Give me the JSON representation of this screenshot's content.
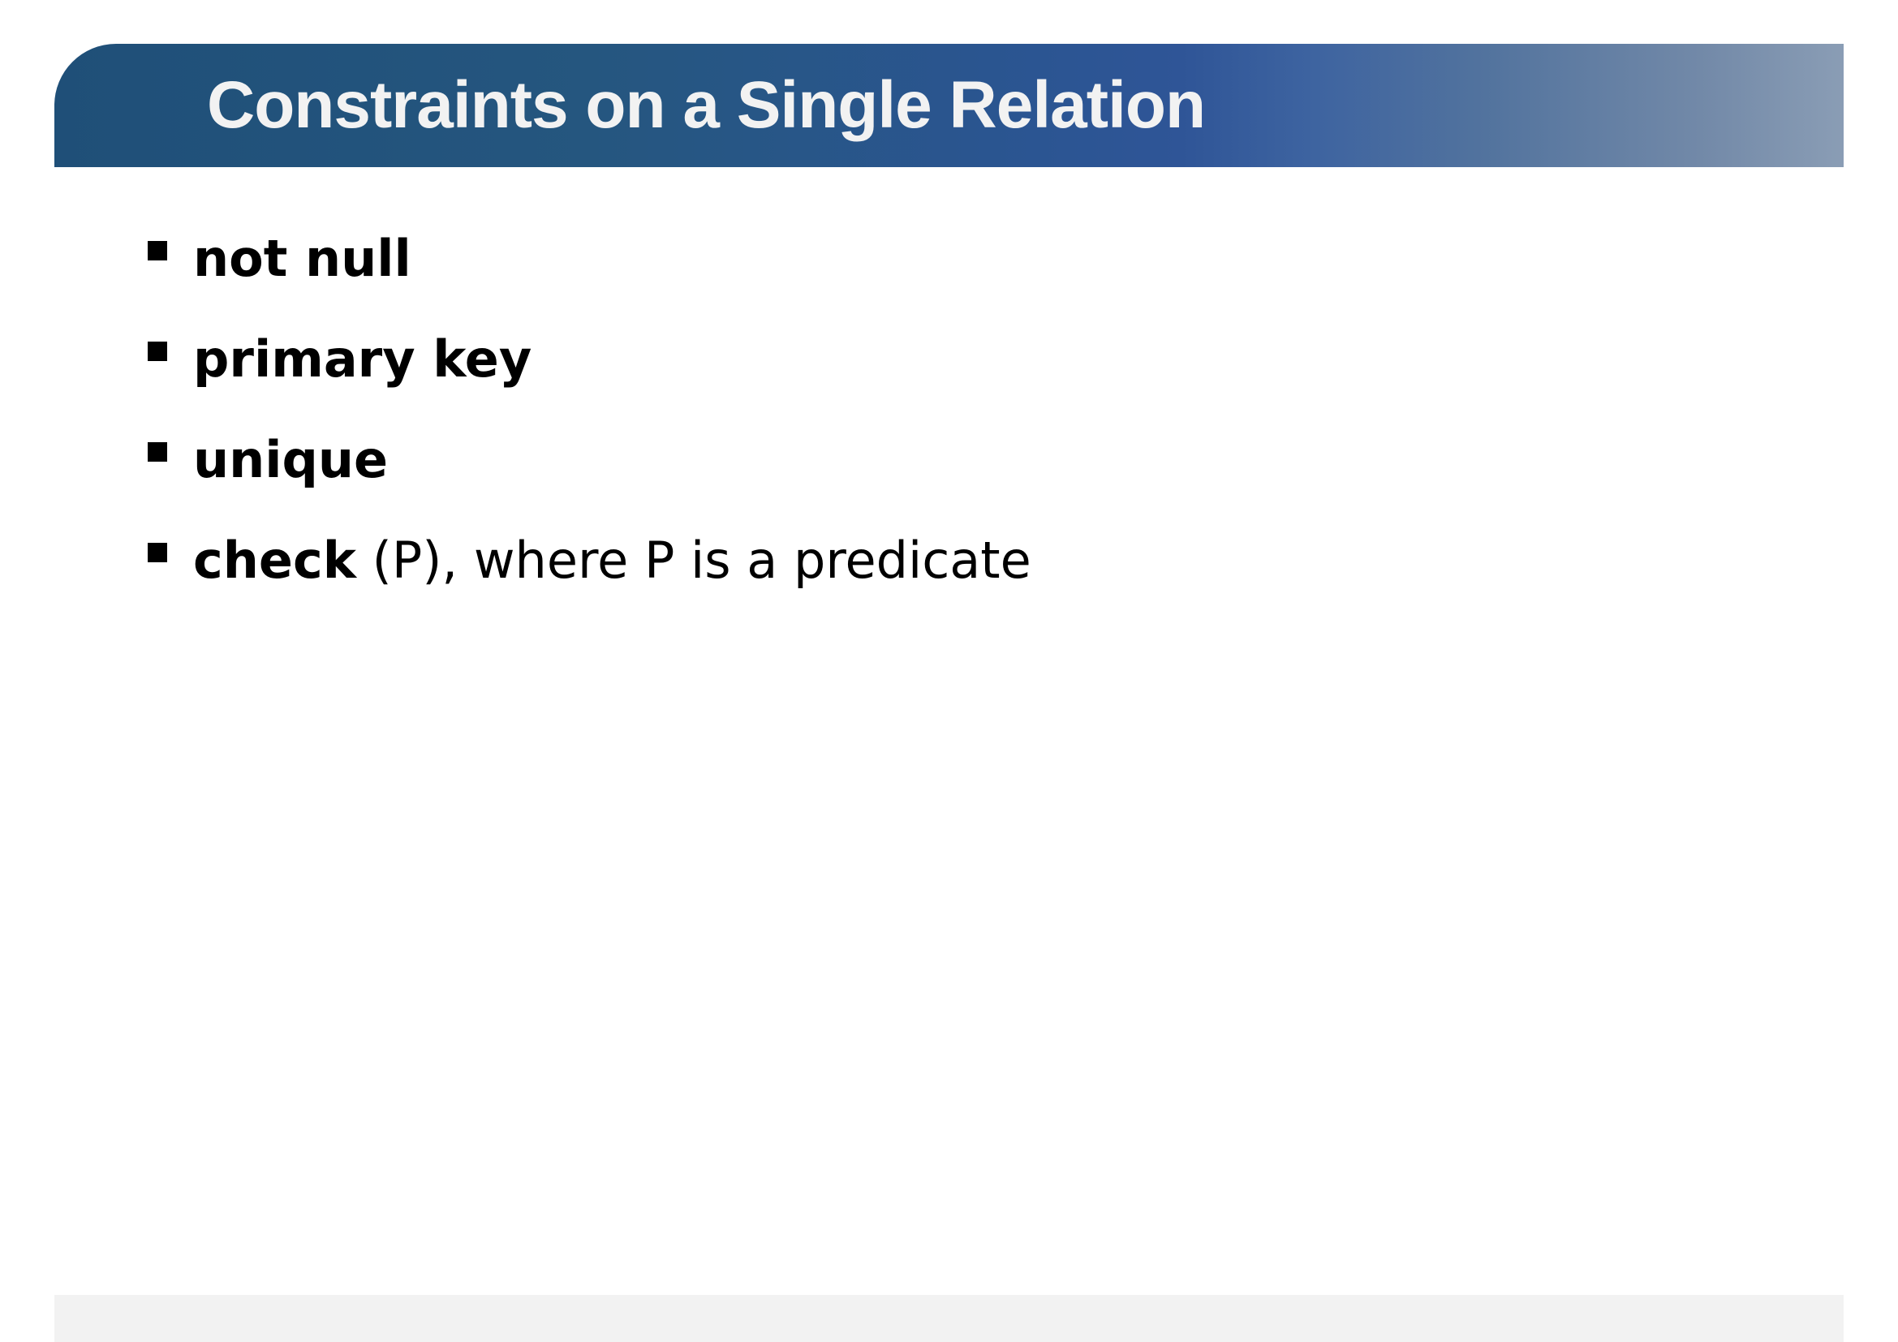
{
  "slide": {
    "title": "Constraints on a Single Relation",
    "bullets": [
      {
        "keyword": "not null",
        "rest": ""
      },
      {
        "keyword": "primary key",
        "rest": ""
      },
      {
        "keyword": "unique",
        "rest": ""
      },
      {
        "keyword": "check",
        "rest": " (P), where P is a predicate"
      }
    ]
  },
  "colors": {
    "title_bar_start": "#1f4f78",
    "title_bar_mid": "#2f5597",
    "title_bar_end": "#8a9db5",
    "title_text": "#f2f2f2",
    "body_text": "#000000",
    "footer_bar": "#f2f2f2"
  }
}
